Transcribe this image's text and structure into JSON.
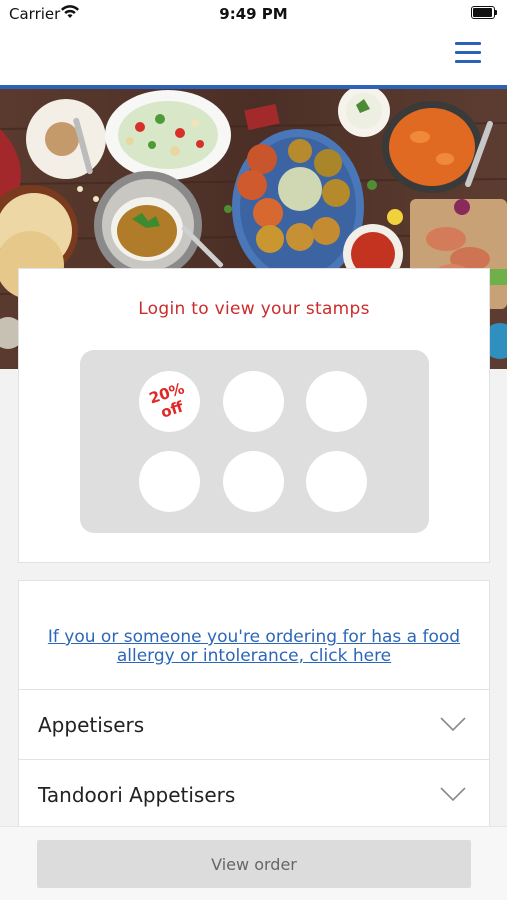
{
  "status_bar": {
    "carrier": "Carrier",
    "time": "9:49 PM",
    "wifi_icon": "wifi-icon",
    "battery_icon": "battery-icon"
  },
  "nav": {
    "menu_icon": "hamburger-menu-icon",
    "accent_color": "#2c62b8"
  },
  "hero": {
    "description_icon": "food-spread-banner"
  },
  "stamps": {
    "title": "Login to view your stamps",
    "title_color": "#cc2b2b",
    "reward_label": "20% off",
    "reward_line_1": "20%",
    "reward_line_2": "off",
    "total_stamps": 6
  },
  "menu": {
    "allergy_link_line_1": "If you or someone you're ordering for has a food",
    "allergy_link_line_2": "allergy or intolerance, click here",
    "link_color": "#2c66b8",
    "categories": [
      {
        "label": "Appetisers",
        "icon": "chevron-down-icon"
      },
      {
        "label": "Tandoori Appetisers",
        "icon": "chevron-down-icon"
      }
    ]
  },
  "footer": {
    "view_order_label": "View order"
  }
}
